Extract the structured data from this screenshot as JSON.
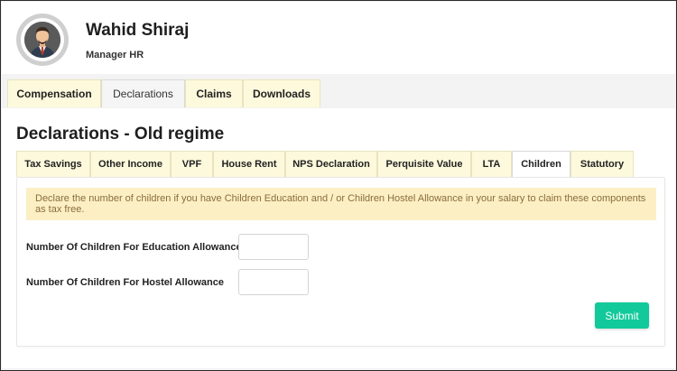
{
  "user": {
    "name": "Wahid Shiraj",
    "title": "Manager HR"
  },
  "main_tabs": [
    {
      "label": "Compensation",
      "active": false
    },
    {
      "label": "Declarations",
      "active": true
    },
    {
      "label": "Claims",
      "active": false
    },
    {
      "label": "Downloads",
      "active": false
    }
  ],
  "page": {
    "title": "Declarations - Old regime"
  },
  "sub_tabs": [
    {
      "label": "Tax Savings",
      "active": false
    },
    {
      "label": "Other Income",
      "active": false
    },
    {
      "label": "VPF",
      "active": false
    },
    {
      "label": "House Rent",
      "active": false
    },
    {
      "label": "NPS Declaration",
      "active": false
    },
    {
      "label": "Perquisite Value",
      "active": false
    },
    {
      "label": "LTA",
      "active": false
    },
    {
      "label": "Children",
      "active": true
    },
    {
      "label": "Statutory",
      "active": false
    }
  ],
  "children_form": {
    "info_text": "Declare the number of children if you have Children Education and / or Children Hostel Allowance in your salary to claim these components as tax free.",
    "education_label": "Number Of Children For Education Allowance",
    "education_value": "",
    "hostel_label": "Number Of Children For Hostel Allowance",
    "hostel_value": "",
    "submit_label": "Submit"
  },
  "colors": {
    "tab_bg": "#fdf9dc",
    "info_bg": "#fcefc4",
    "info_text": "#8a6d3b",
    "submit_bg": "#11c99a"
  },
  "icons": {
    "avatar": "user-avatar-icon"
  }
}
